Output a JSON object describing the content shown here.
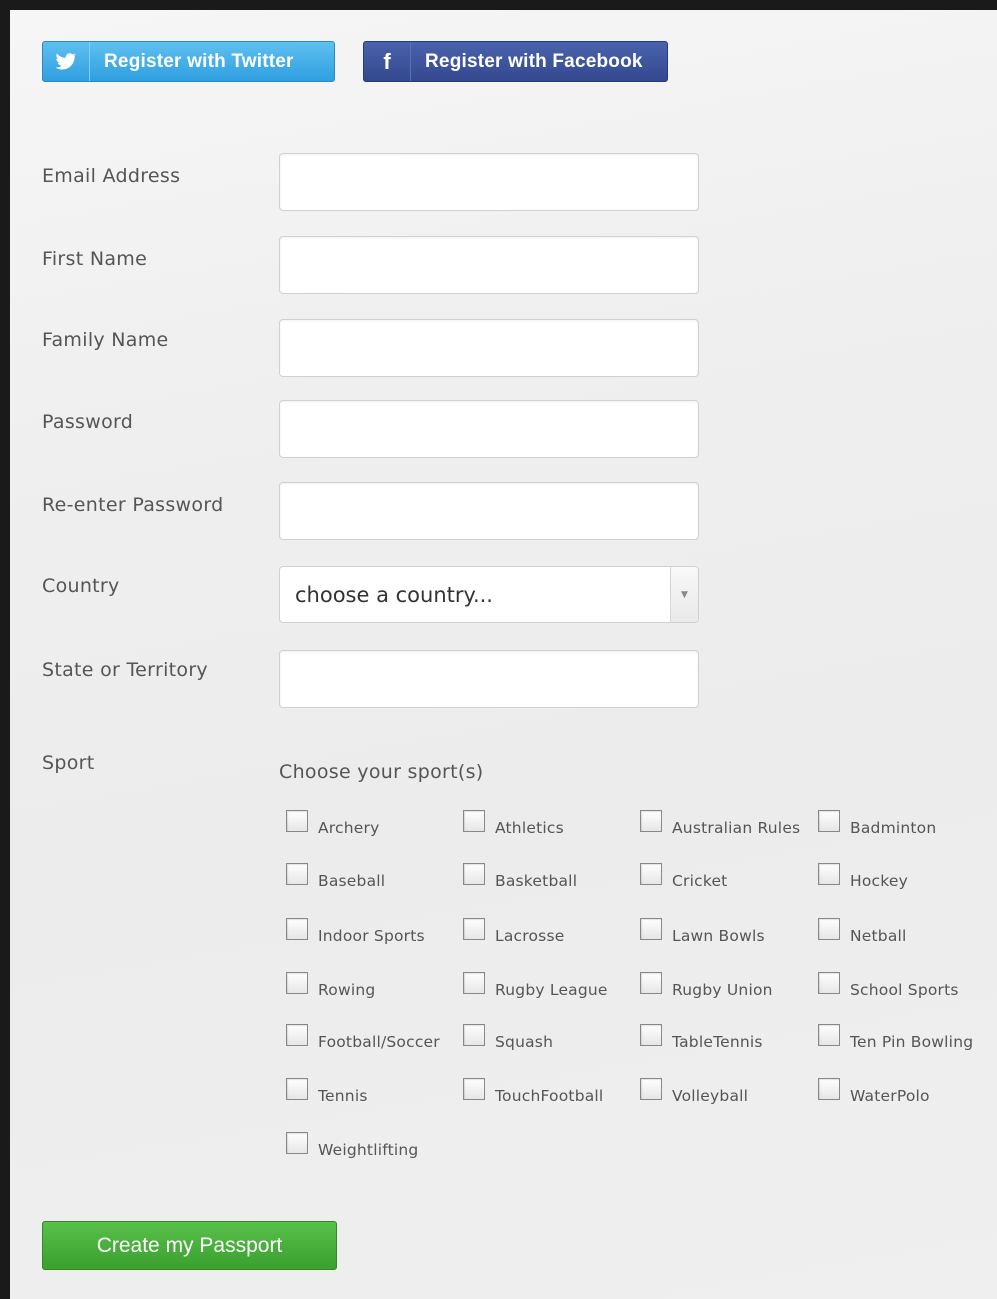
{
  "social": {
    "twitter_label": "Register with Twitter",
    "facebook_label": "Register with Facebook",
    "facebook_glyph": "f"
  },
  "form": {
    "email_label": "Email Address",
    "first_name_label": "First Name",
    "family_name_label": "Family Name",
    "password_label": "Password",
    "reenter_password_label": "Re-enter Password",
    "country_label": "Country",
    "country_value": "choose a country...",
    "state_label": "State or Territory",
    "sport_label": "Sport",
    "sport_heading": "Choose your sport(s)"
  },
  "sports": [
    [
      "Archery",
      "Athletics",
      "Australian Rules",
      "Badminton"
    ],
    [
      "Baseball",
      "Basketball",
      "Cricket",
      "Hockey"
    ],
    [
      "Indoor Sports",
      "Lacrosse",
      "Lawn Bowls",
      "Netball"
    ],
    [
      "Rowing",
      "Rugby League",
      "Rugby Union",
      "School Sports"
    ],
    [
      "Football/Soccer",
      "Squash",
      "TableTennis",
      "Ten Pin Bowling"
    ],
    [
      "Tennis",
      "TouchFootball",
      "Volleyball",
      "WaterPolo"
    ],
    [
      "Weightlifting"
    ]
  ],
  "submit_label": "Create my Passport",
  "colors": {
    "twitter": "#2f9fe0",
    "facebook": "#34488f",
    "submit": "#3aa02e"
  }
}
